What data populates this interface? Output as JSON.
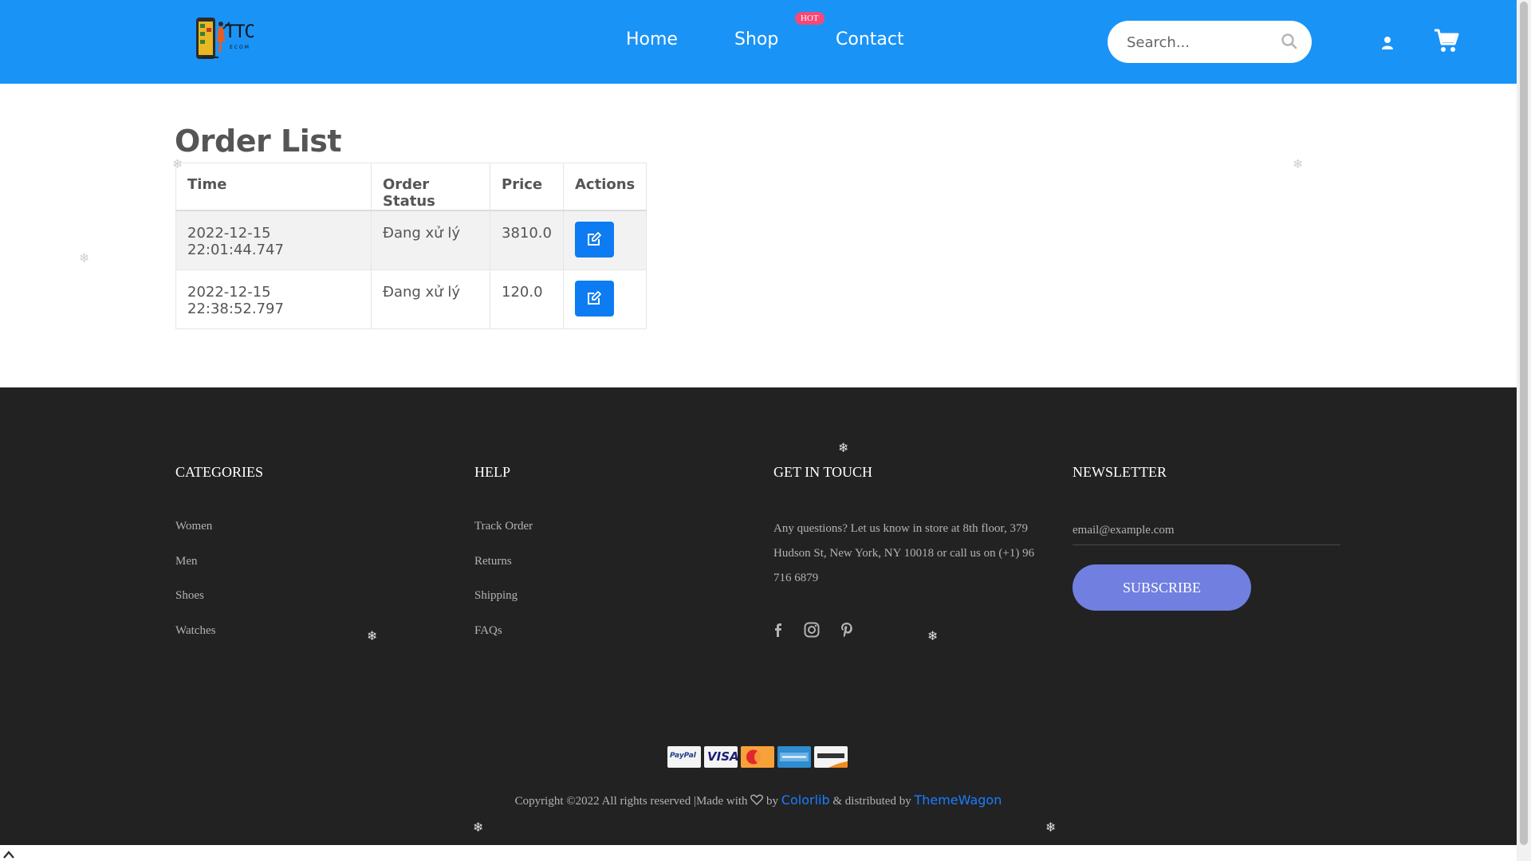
{
  "header": {
    "logo_text": "TTC",
    "logo_subtext": "ECOM",
    "nav": [
      {
        "label": "Home"
      },
      {
        "label": "Shop"
      },
      {
        "label": "Contact"
      }
    ],
    "hot_badge": "HOT",
    "search": {
      "placeholder": "Search..."
    },
    "icons": [
      "search-icon",
      "user-icon",
      "cart-icon"
    ]
  },
  "main": {
    "title": "Order List",
    "table": {
      "columns": [
        "Time",
        "Order Status",
        "Price",
        "Actions"
      ],
      "rows": [
        {
          "time": "2022-12-15 22:01:44.747",
          "status": "Đang xử lý",
          "price": "3810.0",
          "action_icon": "edit-icon"
        },
        {
          "time": "2022-12-15 22:38:52.797",
          "status": "Đang xử lý",
          "price": "120.0",
          "action_icon": "edit-icon"
        }
      ]
    }
  },
  "footer": {
    "categories": {
      "heading": "CATEGORIES",
      "items": [
        "Women",
        "Men",
        "Shoes",
        "Watches"
      ]
    },
    "help": {
      "heading": "HELP",
      "items": [
        "Track Order",
        "Returns",
        "Shipping",
        "FAQs"
      ]
    },
    "contact": {
      "heading": "GET IN TOUCH",
      "text": "Any questions? Let us know in store at 8th floor, 379 Hudson St, New York, NY 10018 or call us on (+1) 96 716 6879",
      "social_icons": [
        "facebook-icon",
        "instagram-icon",
        "pinterest-icon"
      ]
    },
    "newsletter": {
      "heading": "NEWSLETTER",
      "placeholder": "email@example.com",
      "button": "SUBSCRIBE"
    },
    "payments": [
      "PayPal",
      "VISA",
      "MasterCard",
      "American Express",
      "Discover"
    ],
    "copyright": {
      "prefix": "Copyright ©2022 All rights reserved |Made with",
      "by": "by",
      "colorlib": "Colorlib",
      "distributed": "& distributed by",
      "themewagon": "ThemeWagon"
    }
  },
  "colors": {
    "header_bg": "#1a93f7",
    "footer_bg": "#222222",
    "accent_button": "#0d7cf2",
    "subscribe_bg": "#717fe0",
    "hot_badge": "#f74877"
  }
}
